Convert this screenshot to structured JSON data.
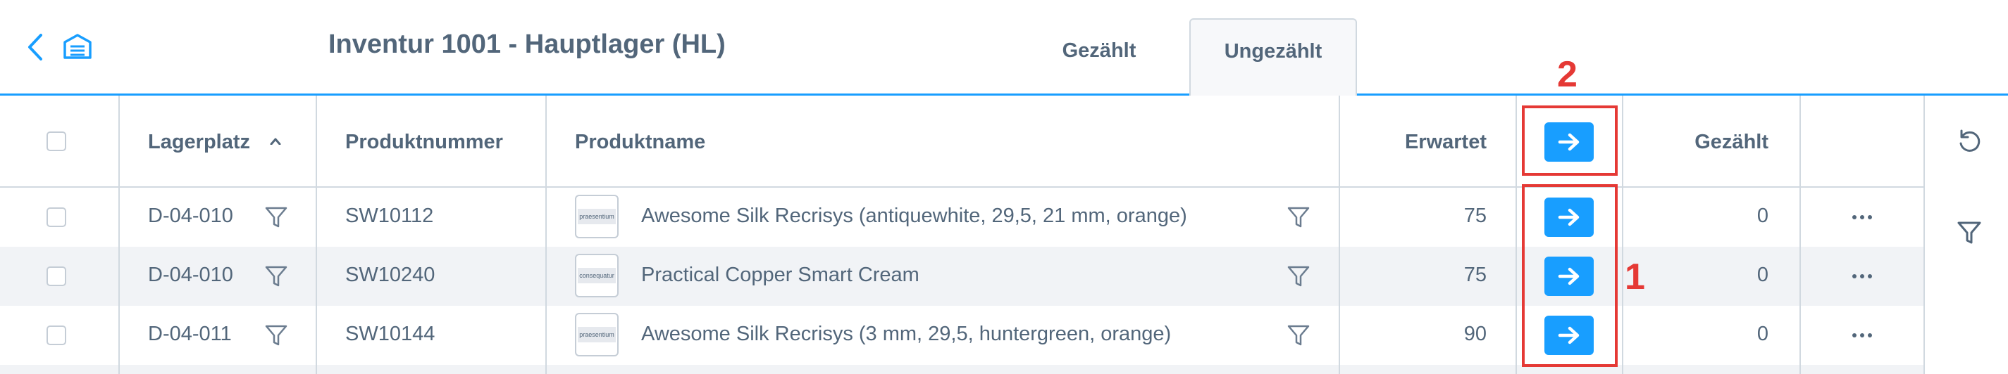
{
  "header": {
    "title": "Inventur 1001 - Hauptlager (HL)",
    "tabs": [
      {
        "label": "Gezählt",
        "active": false
      },
      {
        "label": "Ungezählt",
        "active": true
      }
    ]
  },
  "table": {
    "columns": {
      "location": "Lagerplatz",
      "product_number": "Produktnummer",
      "product_name": "Produktname",
      "expected": "Erwartet",
      "counted": "Gezählt"
    },
    "rows": [
      {
        "location": "D-04-010",
        "product_number": "SW10112",
        "thumb": "praesentium",
        "product_name": "Awesome Silk Recrisys (antiquewhite, 29,5, 21 mm, orange)",
        "expected": "75",
        "counted": "0"
      },
      {
        "location": "D-04-010",
        "product_number": "SW10240",
        "thumb": "consequatur",
        "product_name": "Practical Copper Smart Cream",
        "expected": "75",
        "counted": "0"
      },
      {
        "location": "D-04-011",
        "product_number": "SW10144",
        "thumb": "praesentium",
        "product_name": "Awesome Silk Recrisys (3 mm, 29,5, huntergreen, orange)",
        "expected": "90",
        "counted": "0"
      }
    ]
  },
  "annotations": {
    "row_buttons": "1",
    "header_button": "2",
    "color": "#e53935"
  },
  "colors": {
    "accent": "#189eff",
    "text": "#52667a",
    "border": "#d1d9e0"
  },
  "icons": [
    "chevron-left-icon",
    "warehouse-icon",
    "sort-ascending-icon",
    "filter-icon",
    "arrow-right-icon",
    "more-icon",
    "reset-icon"
  ]
}
